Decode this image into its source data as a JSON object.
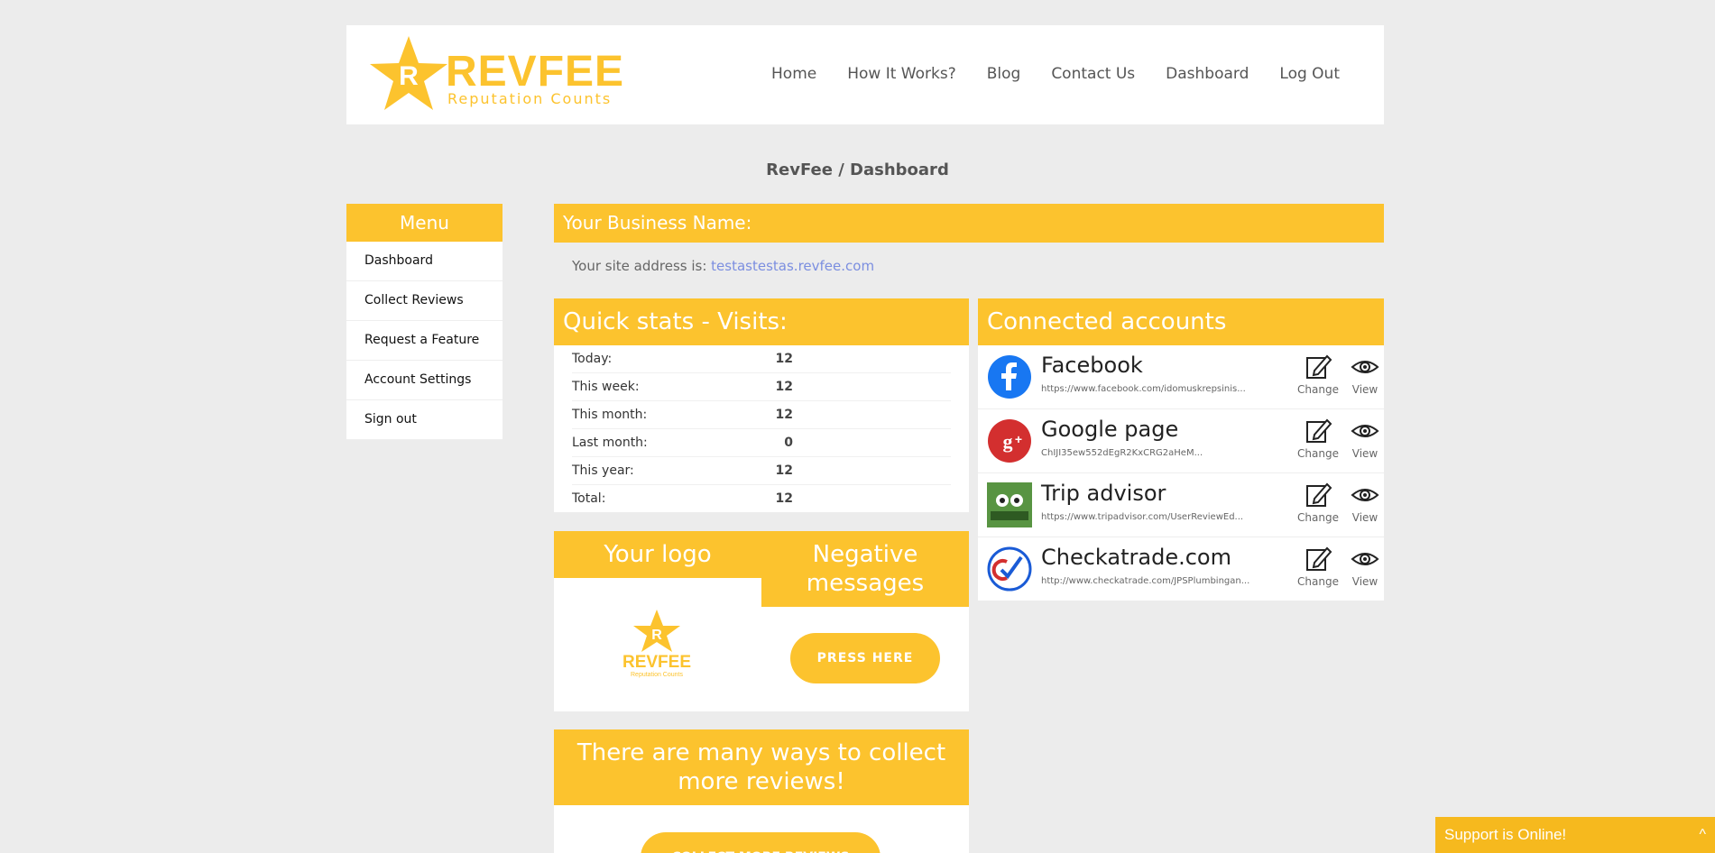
{
  "brand": {
    "name": "REVFEE",
    "tagline": "Reputation Counts"
  },
  "nav": [
    "Home",
    "How It Works?",
    "Blog",
    "Contact Us",
    "Dashboard",
    "Log Out"
  ],
  "breadcrumb": "RevFee / Dashboard",
  "menu": {
    "title": "Menu",
    "items": [
      "Dashboard",
      "Collect Reviews",
      "Request a Feature",
      "Account Settings",
      "Sign out"
    ]
  },
  "business": {
    "title": "Your Business Name:",
    "site_label": "Your site address is:",
    "site_url": "testastestas.revfee.com"
  },
  "stats": {
    "title": "Quick stats - Visits:",
    "rows": [
      {
        "label": "Today:",
        "value": "12"
      },
      {
        "label": "This week:",
        "value": "12"
      },
      {
        "label": "This month:",
        "value": "12"
      },
      {
        "label": "Last month:",
        "value": "0"
      },
      {
        "label": "This year:",
        "value": "12"
      },
      {
        "label": "Total:",
        "value": "12"
      }
    ]
  },
  "logo_box": {
    "title": "Your logo"
  },
  "negative": {
    "title": "Negative messages",
    "button": "PRESS HERE"
  },
  "many_ways": {
    "title": "There are many ways to collect more reviews!",
    "button": "COLLECT MORE REVIEWS"
  },
  "connected": {
    "title": "Connected accounts",
    "change_label": "Change",
    "view_label": "View",
    "accounts": [
      {
        "name": "Facebook",
        "url": "https://www.facebook.com/idomuskrepsinis...",
        "icon": "facebook-icon",
        "color": "#1877f2"
      },
      {
        "name": "Google page",
        "url": "ChIJI35ew552dEgR2KxCRG2aHeM...",
        "icon": "google-plus-icon",
        "color": "#d32f2f"
      },
      {
        "name": "Trip advisor",
        "url": "https://www.tripadvisor.com/UserReviewEd...",
        "icon": "tripadvisor-icon",
        "color": "#589442"
      },
      {
        "name": "Checkatrade.com",
        "url": "http://www.checkatrade.com/JPSPlumbingan...",
        "icon": "checkatrade-icon",
        "color": "#1a5bd6"
      }
    ]
  },
  "support": {
    "label": "Support is Online!",
    "caret": "^"
  },
  "colors": {
    "accent": "#fcc32e",
    "background": "#ececec",
    "link": "#7b8ee0"
  }
}
